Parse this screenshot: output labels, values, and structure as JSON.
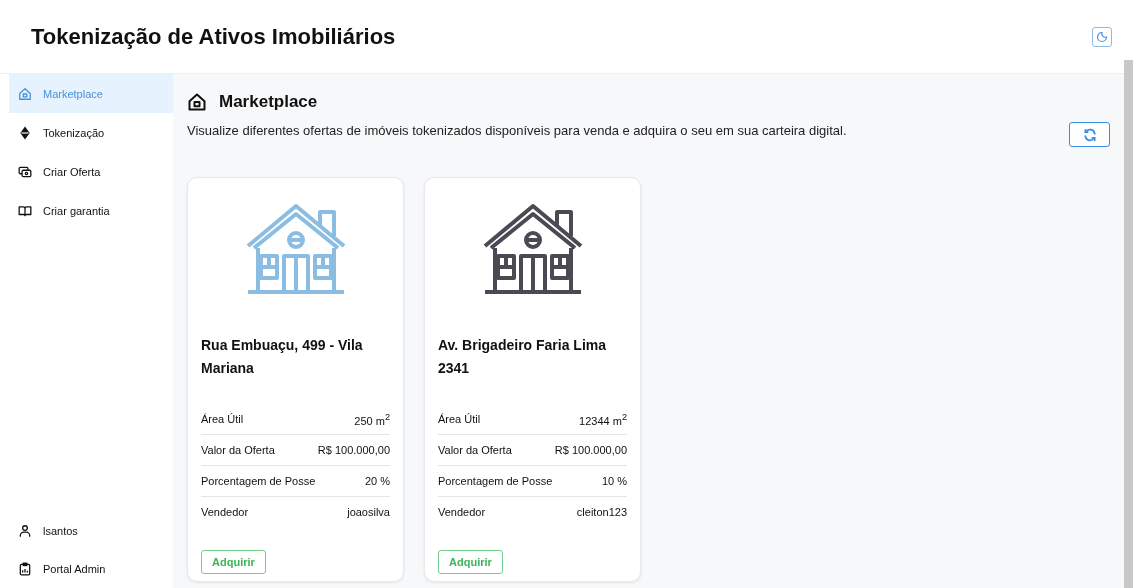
{
  "header": {
    "title": "Tokenização de Ativos Imobiliários"
  },
  "sidebar": {
    "items": [
      {
        "label": "Marketplace",
        "kind": "home",
        "selected": true
      },
      {
        "label": "Tokenização",
        "kind": "token",
        "selected": false
      },
      {
        "label": "Criar Oferta",
        "kind": "offer",
        "selected": false
      },
      {
        "label": "Criar garantia",
        "kind": "book",
        "selected": false
      }
    ],
    "bottom_items": [
      {
        "label": "lsantos",
        "kind": "user",
        "selected": false
      },
      {
        "label": "Portal Admin",
        "kind": "admin",
        "selected": false
      }
    ]
  },
  "page": {
    "title": "Marketplace",
    "description": "Visualize diferentes ofertas de imóveis tokenizados disponíveis para venda e adquira o seu em sua carteira digital."
  },
  "offers": [
    {
      "color": "#8bbde3",
      "address": "Rua Embuaçu, 499 - Vila Mariana",
      "details": [
        {
          "label": "Área Útil",
          "value": "250 m$^{2}$"
        },
        {
          "label": "Valor da Oferta",
          "value": "R$ 100.000,00"
        },
        {
          "label": "Porcentagem de Posse",
          "value": "20 %"
        },
        {
          "label": "Vendedor",
          "value": "joaosilva"
        }
      ],
      "button": "Adquirir"
    },
    {
      "color": "#4a4a55",
      "address": "Av. Brigadeiro Faria Lima 2341",
      "details": [
        {
          "label": "Área Útil",
          "value": "12344 m$^{2}$"
        },
        {
          "label": "Valor da Oferta",
          "value": "R$ 100.000,00"
        },
        {
          "label": "Porcentagem de Posse",
          "value": "10 %"
        },
        {
          "label": "Vendedor",
          "value": "cleiton123"
        }
      ],
      "button": "Adquirir"
    }
  ]
}
